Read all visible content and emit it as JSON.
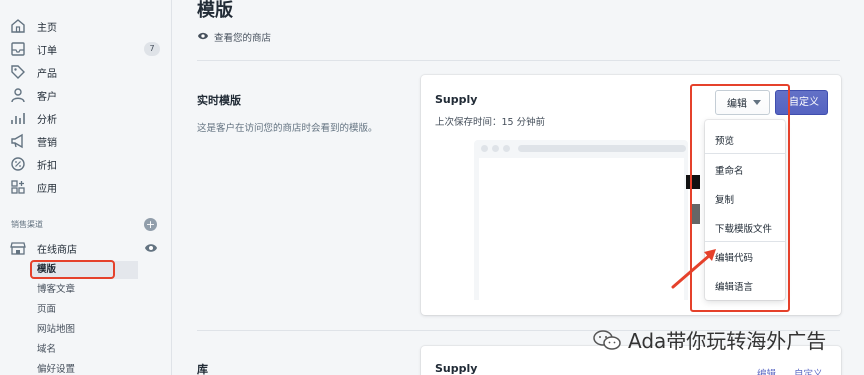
{
  "sidebar": {
    "nav": [
      {
        "label": "主页",
        "icon": "home-icon"
      },
      {
        "label": "订单",
        "icon": "orders-icon",
        "badge": "7"
      },
      {
        "label": "产品",
        "icon": "tag-icon"
      },
      {
        "label": "客户",
        "icon": "person-icon"
      },
      {
        "label": "分析",
        "icon": "analytics-icon"
      },
      {
        "label": "营销",
        "icon": "megaphone-icon"
      },
      {
        "label": "折扣",
        "icon": "discount-icon"
      },
      {
        "label": "应用",
        "icon": "apps-icon"
      }
    ],
    "channels_title": "销售渠道",
    "online_store": "在线商店",
    "sub_items": [
      "模版",
      "博客文章",
      "页面",
      "网站地图",
      "域名",
      "偏好设置"
    ]
  },
  "main": {
    "title": "模版",
    "view_store": "查看您的商店",
    "live_theme": {
      "heading": "实时模版",
      "description": "这是客户在访问您的商店时会看到的模版。",
      "card_title": "Supply",
      "last_saved": "上次保存时间：15 分钟前",
      "edit_button": "编辑",
      "customize_button": "自定义",
      "dropdown": [
        "预览",
        "重命名",
        "复制",
        "下载模版文件",
        "编辑代码",
        "编辑语言"
      ]
    },
    "library": {
      "heading": "库",
      "card_title": "Supply",
      "link_edit": "编辑",
      "link_customize": "自定义"
    }
  },
  "watermark": "Ada带你玩转海外广告",
  "colors": {
    "accent": "#5c6ac4",
    "highlight": "#e5412b"
  }
}
